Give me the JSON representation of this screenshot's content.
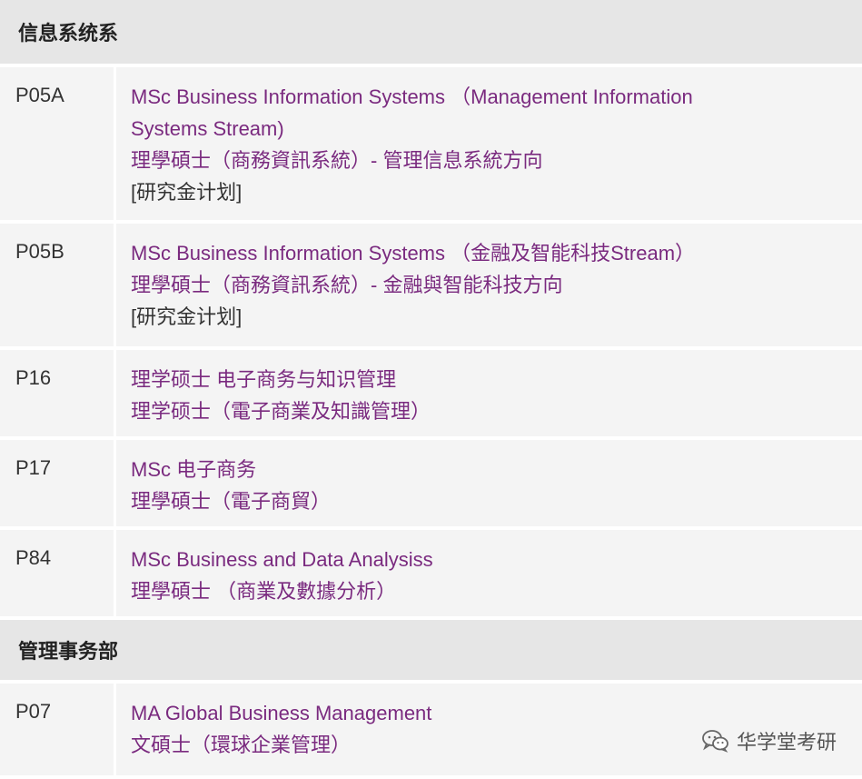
{
  "sections": [
    {
      "title": "信息系统系",
      "rows": [
        {
          "code": "P05A",
          "lines": [
            "MSc Business Information Systems （Management Information",
            "Systems Stream)",
            "理學碩士（商務資訊系統）- 管理信息系統方向"
          ],
          "note": "[研究金计划]"
        },
        {
          "code": "P05B",
          "lines": [
            "MSc Business Information Systems （金融及智能科技Stream）",
            "理學碩士（商務資訊系統）- 金融與智能科技方向"
          ],
          "note": "[研究金计划]"
        },
        {
          "code": "P16",
          "lines": [
            "理学硕士 电子商务与知识管理",
            "理学硕士（電子商業及知識管理）"
          ]
        },
        {
          "code": "P17",
          "lines": [
            "MSc 电子商务",
            "理學碩士（電子商貿）"
          ]
        },
        {
          "code": "P84",
          "lines": [
            "MSc Business and Data Analysiss",
            "理學碩士 （商業及數據分析）"
          ]
        }
      ]
    },
    {
      "title": "管理事务部",
      "rows": [
        {
          "code": "P07",
          "lines": [
            "MA Global Business Management",
            "文碩士（環球企業管理）"
          ]
        }
      ]
    }
  ],
  "watermark": {
    "icon": "wechat-icon",
    "text": "华学堂考研"
  }
}
